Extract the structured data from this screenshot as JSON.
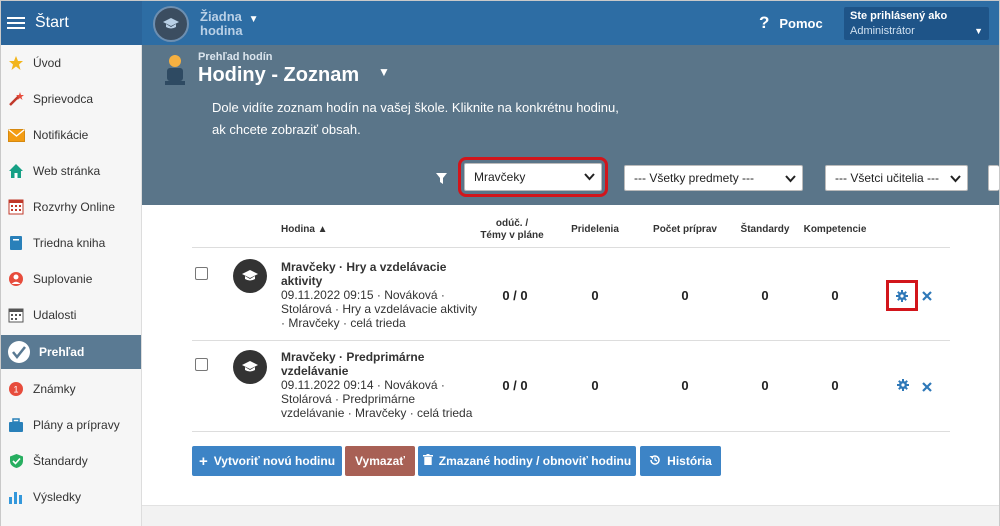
{
  "topbar": {
    "start_label": "Štart",
    "context_line1": "Žiadna",
    "context_line2": "hodina",
    "help_label": "Pomoc",
    "user_line1": "Ste prihlásený ako",
    "user_line2": "Administrátor"
  },
  "sidebar": {
    "items": [
      {
        "label": "Úvod",
        "icon": "star-icon"
      },
      {
        "label": "Sprievodca",
        "icon": "magic-wand-icon"
      },
      {
        "label": "Notifikácie",
        "icon": "envelope-icon"
      },
      {
        "label": "Web stránka",
        "icon": "home-icon"
      },
      {
        "label": "Rozvrhy Online",
        "icon": "calendar-grid-icon"
      },
      {
        "label": "Triedna kniha",
        "icon": "book-icon"
      },
      {
        "label": "Suplovanie",
        "icon": "lifebuoy-icon"
      },
      {
        "label": "Udalosti",
        "icon": "calendar-icon"
      },
      {
        "label": "Prehľad",
        "icon": "check-circle-icon",
        "active": true
      },
      {
        "label": "Známky",
        "icon": "grade-icon"
      },
      {
        "label": "Plány a prípravy",
        "icon": "briefcase-icon"
      },
      {
        "label": "Štandardy",
        "icon": "shield-icon"
      },
      {
        "label": "Výsledky",
        "icon": "bar-chart-icon"
      }
    ]
  },
  "header": {
    "subtitle": "Prehľad hodín",
    "title": "Hodiny - Zoznam",
    "description": "Dole vidíte zoznam hodín na vašej škole. Kliknite na konkrétnu hodinu, ak chcete zobraziť obsah."
  },
  "filters": {
    "class_value": "Mravčeky",
    "subject_value": "--- Všetky predmety ---",
    "teacher_value": "--- Všetci učitelia ---"
  },
  "table": {
    "headers": {
      "hodina": "Hodina ▲",
      "oduc_line1": "odúč. /",
      "oduc_line2": "Témy v pláne",
      "pridelenia": "Pridelenia",
      "pocet": "Počet príprav",
      "standardy": "Štandardy",
      "kompetencie": "Kompetencie"
    },
    "rows": [
      {
        "title_line1": "Mravčeky · Hry a vzdelávacie",
        "title_line2": "aktivity",
        "detail_line1": "09.11.2022 09:15 · Nováková ·",
        "detail_line2": "Stolárová · Hry a vzdelávacie aktivity",
        "detail_line3": "· Mravčeky · celá trieda",
        "oduc": "0 / 0",
        "pridelenia": "0",
        "pocet": "0",
        "standardy": "0",
        "kompetencie": "0"
      },
      {
        "title_line1": "Mravčeky · Predprimárne",
        "title_line2": "vzdelávanie",
        "detail_line1": "09.11.2022 09:14 · Nováková ·",
        "detail_line2": "Stolárová · Predprimárne",
        "detail_line3": "vzdelávanie · Mravčeky · celá trieda",
        "oduc": "0 / 0",
        "pridelenia": "0",
        "pocet": "0",
        "standardy": "0",
        "kompetencie": "0"
      }
    ]
  },
  "buttons": {
    "create": "Vytvoriť novú hodinu",
    "delete": "Vymazať",
    "deleted": "Zmazané hodiny / obnoviť hodinu",
    "history": "História"
  },
  "colors": {
    "topbar": "#2d6da4",
    "header": "#5a7589",
    "highlight": "#d2151b",
    "button_blue": "#3d84c6"
  }
}
